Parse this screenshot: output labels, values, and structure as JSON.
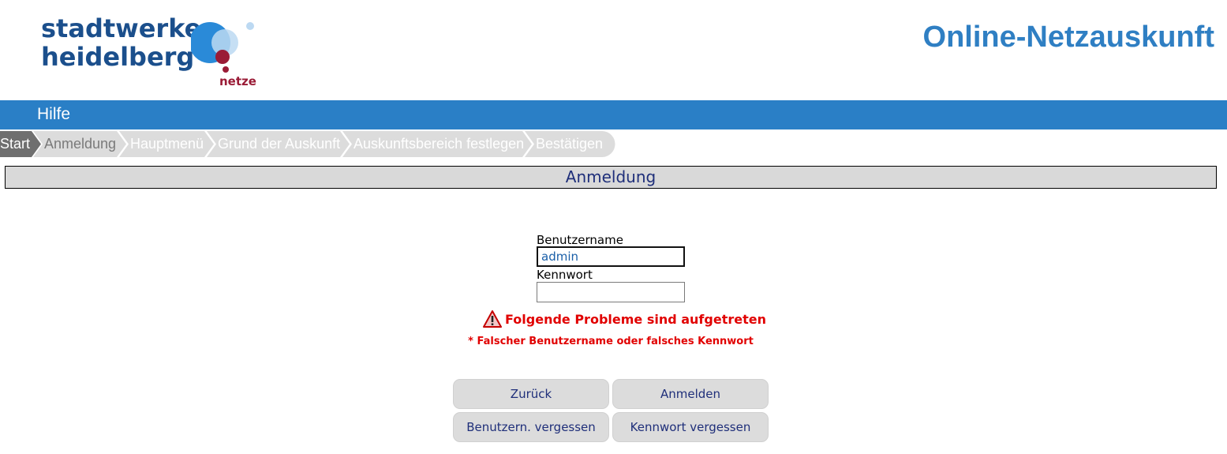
{
  "brand": {
    "line1": "stadtwerke",
    "line2": "heidelberg",
    "sub": "netze",
    "colors": {
      "primary": "#1b4f8c",
      "accent": "#2a8ad8",
      "light": "#bcd9f2",
      "red": "#9a1b36"
    }
  },
  "header": {
    "app_title": "Online-Netzauskunft"
  },
  "menu": {
    "help_label": "Hilfe",
    "bar_color": "#2a7fc6"
  },
  "steps": [
    {
      "label": "Start",
      "state": "done"
    },
    {
      "label": "Anmeldung",
      "state": "current"
    },
    {
      "label": "Hauptmenü",
      "state": "pending"
    },
    {
      "label": "Grund der Auskunft",
      "state": "pending"
    },
    {
      "label": "Auskunftsbereich festlegen",
      "state": "pending"
    },
    {
      "label": "Bestätigen",
      "state": "pending"
    }
  ],
  "section": {
    "title": "Anmeldung"
  },
  "form": {
    "username_label": "Benutzername",
    "username_value": "admin",
    "password_label": "Kennwort",
    "password_value": ""
  },
  "error": {
    "title": "Folgende Probleme sind aufgetreten",
    "detail": "* Falscher Benutzername oder falsches Kennwort",
    "icon": "warning-icon",
    "color": "#e10000"
  },
  "buttons": {
    "back": "Zurück",
    "login": "Anmelden",
    "forgot_username": "Benutzern. vergessen",
    "forgot_password": "Kennwort vergessen"
  }
}
